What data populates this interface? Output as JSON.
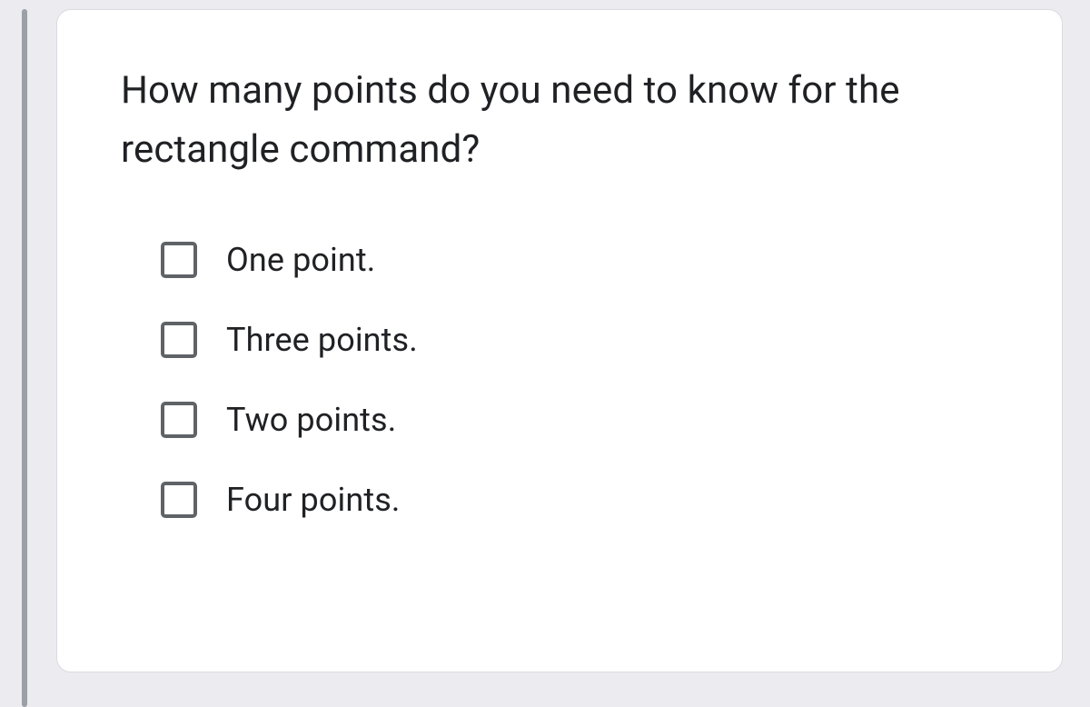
{
  "question": "How many points do you need to know for the rectangle command?",
  "options": [
    {
      "label": "One point."
    },
    {
      "label": "Three points."
    },
    {
      "label": "Two points."
    },
    {
      "label": "Four points."
    }
  ]
}
